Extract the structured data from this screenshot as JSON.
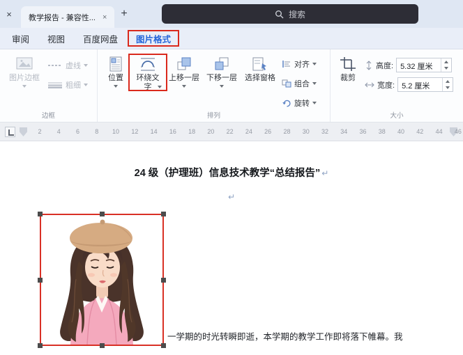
{
  "titlebar": {
    "doc_tab_label": "教学报告 - 兼容性...",
    "search_placeholder": "搜索"
  },
  "icons": {
    "close": "×",
    "tab_close": "×",
    "plus": "+"
  },
  "ribbon_tabs": {
    "review": "审阅",
    "view": "视图",
    "baidu": "百度网盘",
    "picture_format": "图片格式"
  },
  "ribbon": {
    "border_group": {
      "label": "边框",
      "picture_border": "图片边框",
      "dash_style": "虚线",
      "line_weight": "粗细"
    },
    "arrange_group": {
      "label": "排列",
      "position": "位置",
      "wrap_text": "环绕文字",
      "bring_forward": "上移一层",
      "send_backward": "下移一层",
      "selection_pane": "选择窗格",
      "align": "对齐",
      "group": "组合",
      "rotate": "旋转"
    },
    "size_group": {
      "label": "大小",
      "crop": "裁剪",
      "height_label": "高度:",
      "height_value": "5.32 厘米",
      "width_label": "宽度:",
      "width_value": "5.2 厘米"
    }
  },
  "ruler": {
    "ticks": [
      "2",
      "4",
      "6",
      "8",
      "10",
      "12",
      "14",
      "16",
      "18",
      "20",
      "22",
      "24",
      "26",
      "28",
      "30",
      "32",
      "34",
      "36",
      "38",
      "40",
      "42",
      "44",
      "46"
    ]
  },
  "document": {
    "title": "24 级（护理班）信息技术教学“总结报告”",
    "paragraph_mark": "↵",
    "body_text": "一学期的时光转瞬即逝，本学期的教学工作即将落下帷幕。我"
  },
  "colors": {
    "annotation_red": "#da291c",
    "active_tab_blue": "#2666d9",
    "search_bg": "#2d2d36",
    "titlebar_bg": "#dfe7f3"
  }
}
